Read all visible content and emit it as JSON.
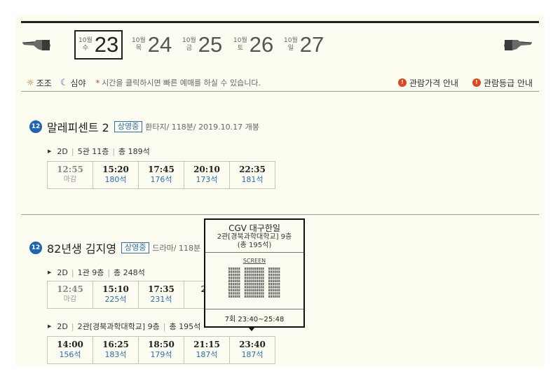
{
  "dates": [
    {
      "month": "10월",
      "weekday": "수",
      "day": "23",
      "selected": true
    },
    {
      "month": "10월",
      "weekday": "목",
      "day": "24",
      "selected": false
    },
    {
      "month": "10월",
      "weekday": "금",
      "day": "25",
      "selected": false
    },
    {
      "month": "10월",
      "weekday": "토",
      "day": "26",
      "selected": false
    },
    {
      "month": "10월",
      "weekday": "일",
      "day": "27",
      "selected": false
    }
  ],
  "legend": {
    "morning": "조조",
    "night": "심야",
    "note": "시간을 클릭하시면 빠른 예매를 하실 수 있습니다."
  },
  "links": {
    "price": "관람가격 안내",
    "rating": "관람등급 안내"
  },
  "movies": [
    {
      "age": "12",
      "title": "말레피센트 2",
      "status": "상영중",
      "info": "환타지/ 118분/ 2019.10.17 개봉",
      "halls": [
        {
          "format": "2D",
          "room": "5관 11층",
          "total": "총 189석",
          "slots": [
            {
              "time": "12:55",
              "seats": "마감",
              "closed": true
            },
            {
              "time": "15:20",
              "seats": "180석",
              "closed": false
            },
            {
              "time": "17:45",
              "seats": "176석",
              "closed": false
            },
            {
              "time": "20:10",
              "seats": "173석",
              "closed": false
            },
            {
              "time": "22:35",
              "seats": "181석",
              "closed": false
            }
          ]
        }
      ]
    },
    {
      "age": "12",
      "title": "82년생 김지영",
      "status": "상영중",
      "info": "드라마/ 118분",
      "halls": [
        {
          "format": "2D",
          "room": "1관 9층",
          "total": "총 248석",
          "slots": [
            {
              "time": "12:45",
              "seats": "마감",
              "closed": true
            },
            {
              "time": "15:10",
              "seats": "225석",
              "closed": false
            },
            {
              "time": "17:35",
              "seats": "231석",
              "closed": false
            },
            {
              "time": "20",
              "seats": "2",
              "closed": false
            }
          ]
        },
        {
          "format": "2D",
          "room": "2관[경북과학대학교] 9층",
          "total": "총 195석",
          "slots": [
            {
              "time": "14:00",
              "seats": "156석",
              "closed": false
            },
            {
              "time": "16:25",
              "seats": "183석",
              "closed": false
            },
            {
              "time": "18:50",
              "seats": "179석",
              "closed": false
            },
            {
              "time": "21:15",
              "seats": "187석",
              "closed": false
            },
            {
              "time": "23:40",
              "seats": "187석",
              "closed": false
            }
          ]
        }
      ]
    }
  ],
  "popup": {
    "theater": "CGV 대구한일",
    "hall": "2관[경북과학대학교] 9층",
    "total": "(총 195석)",
    "screen": "SCREEN",
    "time": "7회 23:40~25:48"
  },
  "colors": {
    "background": "#fdfcf0",
    "accent_blue": "#2a6eb5",
    "age_badge": "#1d63b8",
    "info_icon": "#e0461e"
  }
}
